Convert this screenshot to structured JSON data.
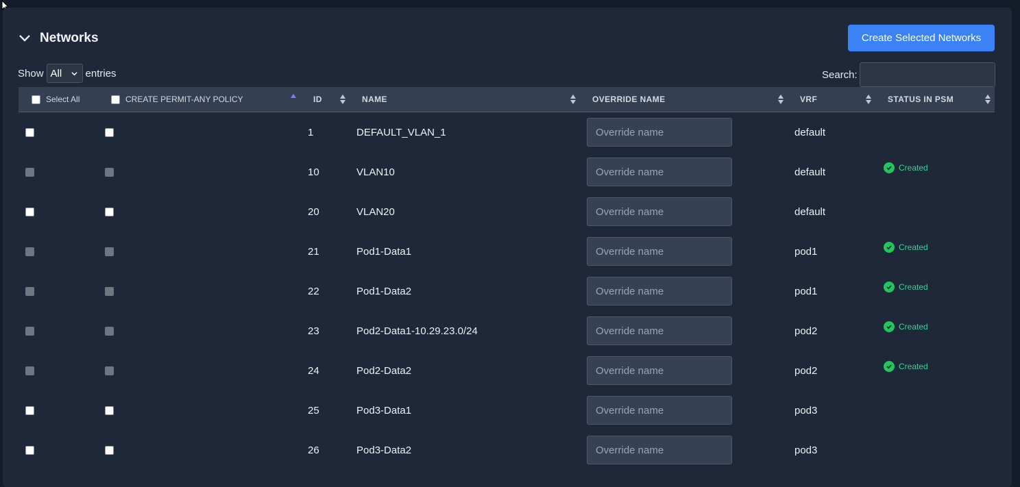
{
  "section": {
    "title": "Networks",
    "create_button": "Create Selected Networks"
  },
  "controls": {
    "show_label": "Show",
    "show_value": "All",
    "entries_label": "entries",
    "search_label": "Search:"
  },
  "columns": {
    "select_all": "Select All",
    "permit_any": "CREATE PERMIT-ANY POLICY",
    "id": "ID",
    "name": "NAME",
    "override_name": "OVERRIDE NAME",
    "vrf": "VRF",
    "status": "STATUS IN PSM"
  },
  "override_placeholder": "Override name",
  "rows": [
    {
      "id": "1",
      "name": "DEFAULT_VLAN_1",
      "vrf": "default",
      "status": "",
      "disabled": false
    },
    {
      "id": "10",
      "name": "VLAN10",
      "vrf": "default",
      "status": "Created",
      "disabled": true
    },
    {
      "id": "20",
      "name": "VLAN20",
      "vrf": "default",
      "status": "",
      "disabled": false
    },
    {
      "id": "21",
      "name": "Pod1-Data1",
      "vrf": "pod1",
      "status": "Created",
      "disabled": true
    },
    {
      "id": "22",
      "name": "Pod1-Data2",
      "vrf": "pod1",
      "status": "Created",
      "disabled": true
    },
    {
      "id": "23",
      "name": "Pod2-Data1-10.29.23.0/24",
      "vrf": "pod2",
      "status": "Created",
      "disabled": true
    },
    {
      "id": "24",
      "name": "Pod2-Data2",
      "vrf": "pod2",
      "status": "Created",
      "disabled": true
    },
    {
      "id": "25",
      "name": "Pod3-Data1",
      "vrf": "pod3",
      "status": "",
      "disabled": false
    },
    {
      "id": "26",
      "name": "Pod3-Data2",
      "vrf": "pod3",
      "status": "",
      "disabled": false
    }
  ],
  "colors": {
    "accent": "#3b82f6",
    "status_green": "#22c55e",
    "background": "#1f2838"
  }
}
